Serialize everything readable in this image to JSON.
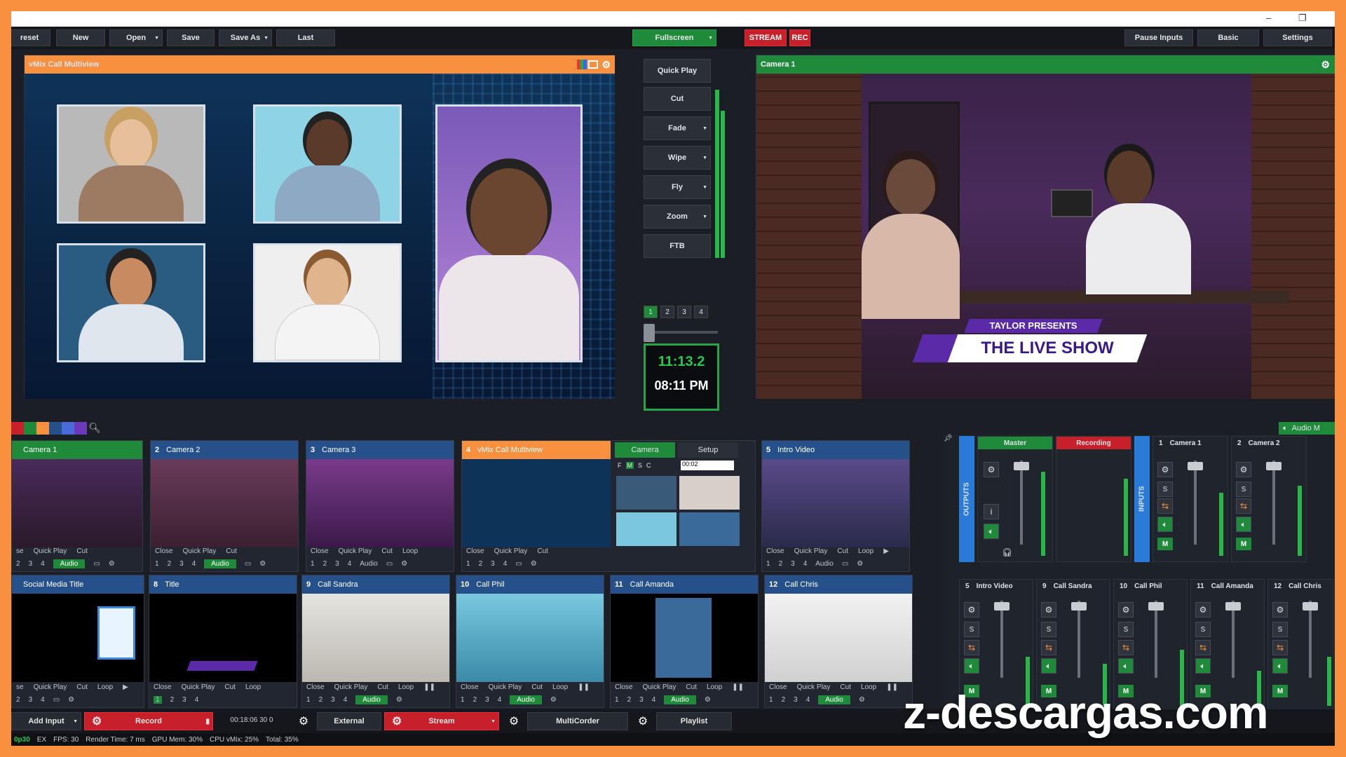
{
  "app": {
    "accent_green": "#1f8a3a",
    "accent_orange": "#f7903f",
    "accent_blue": "#25508a",
    "accent_red": "#c8202a"
  },
  "toolbar": {
    "preset": "reset",
    "new": "New",
    "open": "Open",
    "save": "Save",
    "save_as": "Save As",
    "last": "Last",
    "fullscreen": "Fullscreen",
    "stream": "STREAM",
    "rec": "REC",
    "pause_inputs": "Pause Inputs",
    "basic": "Basic",
    "settings": "Settings"
  },
  "preview": {
    "title": "vMix Call Multiview"
  },
  "transitions": {
    "buttons": [
      "Quick Play",
      "Cut",
      "Fade",
      "Wipe",
      "Fly",
      "Zoom",
      "FTB"
    ],
    "numbers": [
      "1",
      "2",
      "3",
      "4"
    ],
    "clock_time": "11:13.2",
    "clock_now": "08:11 PM"
  },
  "output": {
    "title": "Camera 1",
    "lowerthird_top": "TAYLOR PRESENTS",
    "lowerthird_main": "THE LIVE SHOW"
  },
  "inputs_row1": [
    {
      "num": "",
      "name": "Camera 1",
      "c1": [
        "se",
        "Quick Play",
        "Cut"
      ],
      "c2": [
        "2",
        "3",
        "4",
        "Audio"
      ]
    },
    {
      "num": "2",
      "name": "Camera 2",
      "c1": [
        "Close",
        "Quick Play",
        "Cut"
      ],
      "c2": [
        "1",
        "2",
        "3",
        "4",
        "Audio"
      ]
    },
    {
      "num": "3",
      "name": "Camera 3",
      "c1": [
        "Close",
        "Quick Play",
        "Cut",
        "Loop"
      ],
      "c2": [
        "1",
        "2",
        "3",
        "4",
        "Audio"
      ]
    },
    {
      "num": "4",
      "name": "vMix Call Multiview",
      "c1": [
        "Close",
        "Quick Play",
        "Cut"
      ],
      "c2": [
        "1",
        "2",
        "3",
        "4"
      ]
    },
    {
      "num": "5",
      "name": "Intro Video",
      "c1": [
        "Close",
        "Quick Play",
        "Cut",
        "Loop"
      ],
      "c2": [
        "1",
        "2",
        "3",
        "4",
        "Audio"
      ]
    }
  ],
  "call_tabs": {
    "camera": "Camera",
    "setup": "Setup",
    "flags": [
      "F",
      "M",
      "S",
      "C"
    ],
    "timer": "00:02"
  },
  "inputs_row2": [
    {
      "num": "",
      "name": "Social Media Title",
      "c1": [
        "se",
        "Quick Play",
        "Cut",
        "Loop"
      ],
      "c2": [
        "2",
        "3",
        "4"
      ]
    },
    {
      "num": "8",
      "name": "Title",
      "c1": [
        "Close",
        "Quick Play",
        "Cut",
        "Loop"
      ],
      "c2": [
        "1",
        "2",
        "3",
        "4"
      ]
    },
    {
      "num": "9",
      "name": "Call Sandra",
      "c1": [
        "Close",
        "Quick Play",
        "Cut",
        "Loop"
      ],
      "c2": [
        "1",
        "2",
        "3",
        "4",
        "Audio"
      ]
    },
    {
      "num": "10",
      "name": "Call Phil",
      "c1": [
        "Close",
        "Quick Play",
        "Cut",
        "Loop"
      ],
      "c2": [
        "1",
        "2",
        "3",
        "4",
        "Audio"
      ]
    },
    {
      "num": "11",
      "name": "Call Amanda",
      "c1": [
        "Close",
        "Quick Play",
        "Cut",
        "Loop"
      ],
      "c2": [
        "1",
        "2",
        "3",
        "4",
        "Audio"
      ]
    },
    {
      "num": "12",
      "name": "Call Chris",
      "c1": [
        "Close",
        "Quick Play",
        "Cut",
        "Loop"
      ],
      "c2": [
        "1",
        "2",
        "3",
        "4",
        "Audio"
      ]
    }
  ],
  "mixer": {
    "audio_tab": "Audio M",
    "outputs": "OUTPUTS",
    "inputs": "INPUTS",
    "master": "Master",
    "recording": "Recording",
    "strips_top": [
      {
        "num": "1",
        "name": "Camera 1"
      },
      {
        "num": "2",
        "name": "Camera 2"
      }
    ],
    "strips_bottom": [
      {
        "num": "5",
        "name": "Intro Video"
      },
      {
        "num": "9",
        "name": "Call Sandra"
      },
      {
        "num": "10",
        "name": "Call Phil"
      },
      {
        "num": "11",
        "name": "Call Amanda"
      },
      {
        "num": "12",
        "name": "Call Chris"
      }
    ]
  },
  "bottombar": {
    "add_input": "Add Input",
    "record": "Record",
    "rec_time": "00:18:06 30 0",
    "external": "External",
    "stream": "Stream",
    "multicorder": "MultiCorder",
    "playlist": "Playlist"
  },
  "status": {
    "res": "0p30",
    "ex": "EX",
    "fps": "FPS: 30",
    "render": "Render Time: 7 ms",
    "gpu": "GPU Mem: 30%",
    "cpu": "CPU vMix: 25%",
    "total": "Total: 35%"
  },
  "watermark": "z-descargas.com"
}
